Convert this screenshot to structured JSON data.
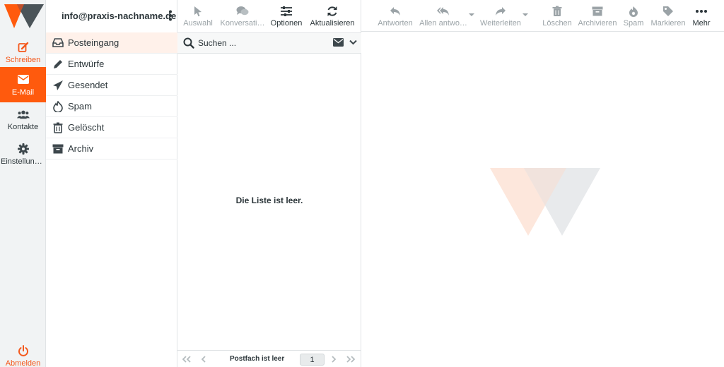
{
  "rail": {
    "compose": "Schreiben",
    "mail": "E-Mail",
    "contacts": "Kontakte",
    "settings": "Einstellungen",
    "logout": "Abmelden"
  },
  "account": "info@praxis-nachname.de",
  "folders": [
    {
      "label": "Posteingang",
      "icon": "inbox-icon"
    },
    {
      "label": "Entwürfe",
      "icon": "pencil-icon"
    },
    {
      "label": "Gesendet",
      "icon": "paper-plane-icon"
    },
    {
      "label": "Spam",
      "icon": "fire-icon"
    },
    {
      "label": "Gelöscht",
      "icon": "trash-icon"
    },
    {
      "label": "Archiv",
      "icon": "archive-icon"
    }
  ],
  "list_toolbar": {
    "select": "Auswahl",
    "threads": "Konversati…",
    "options": "Optionen",
    "refresh": "Aktualisieren"
  },
  "search": {
    "placeholder": "Suchen ..."
  },
  "list": {
    "empty_text": "Die Liste ist leer."
  },
  "pager": {
    "status": "Postfach ist leer",
    "page": "1"
  },
  "message_toolbar": {
    "reply": "Antworten",
    "reply_all": "Allen antwo…",
    "forward": "Weiterleiten",
    "delete": "Löschen",
    "archive": "Archivieren",
    "spam": "Spam",
    "mark": "Markieren",
    "more": "Mehr"
  },
  "colors": {
    "accent": "#ff5a0d",
    "active_folder_bg": "#fff1ea",
    "disabled_text": "#9ba3a7",
    "text": "#2c363a"
  }
}
